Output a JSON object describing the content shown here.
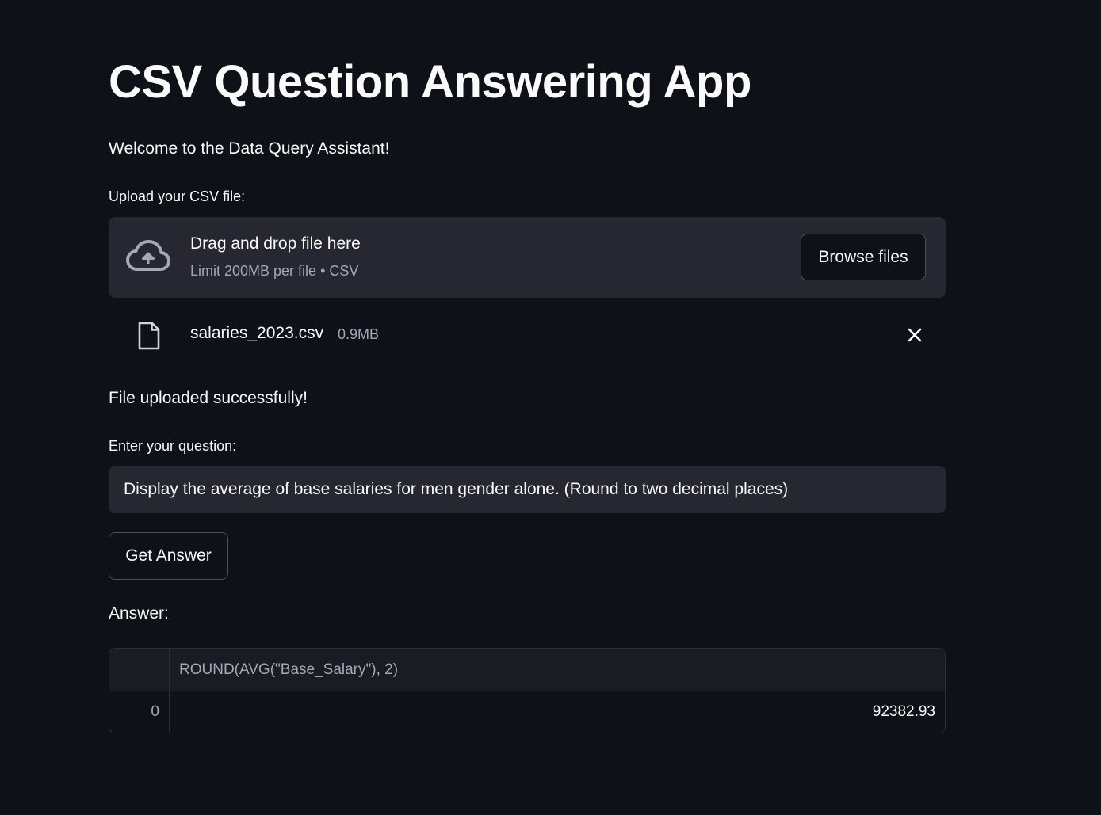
{
  "app": {
    "title": "CSV Question Answering App",
    "welcome": "Welcome to the Data Query Assistant!"
  },
  "uploader": {
    "label": "Upload your CSV file:",
    "drop_title": "Drag and drop file here",
    "limit_text": "Limit 200MB per file • CSV",
    "browse_label": "Browse files",
    "icon": "cloud-upload-icon"
  },
  "uploaded_file": {
    "name": "salaries_2023.csv",
    "size": "0.9MB",
    "icon": "file-icon",
    "remove_icon": "close-icon"
  },
  "status": {
    "message": "File uploaded successfully!"
  },
  "question": {
    "label": "Enter your question:",
    "value": "Display the average of base salaries for men gender alone. (Round to two decimal places)"
  },
  "actions": {
    "get_answer_label": "Get Answer"
  },
  "answer": {
    "label": "Answer:",
    "table": {
      "columns": [
        "ROUND(AVG(\"Base_Salary\"), 2)"
      ],
      "rows": [
        {
          "index": "0",
          "values": [
            "92382.93"
          ]
        }
      ]
    }
  },
  "colors": {
    "background": "#0e1117",
    "surface": "#262730",
    "text": "#fafafa",
    "muted_text": "#a3a8b8"
  }
}
